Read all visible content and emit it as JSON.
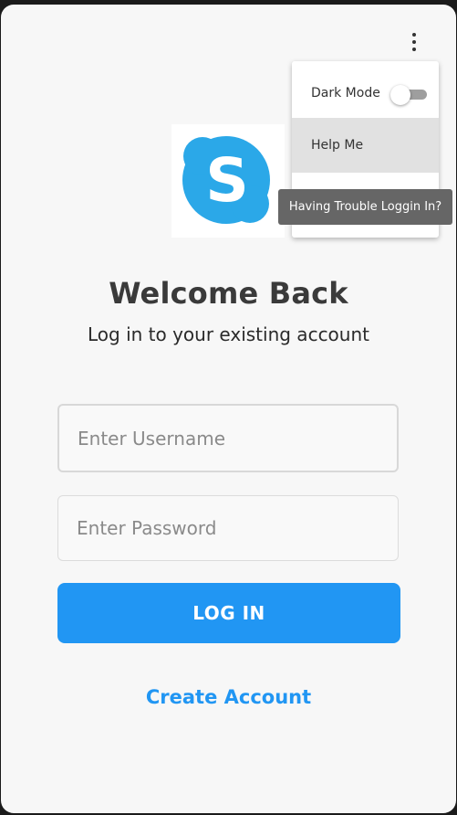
{
  "header": {
    "menu_icon": "more-vertical-icon"
  },
  "logo": {
    "icon": "skype-logo",
    "letter": "S",
    "color": "#2ba8e8"
  },
  "login": {
    "title": "Welcome Back",
    "subtitle": "Log in to your existing account",
    "username_placeholder": "Enter Username",
    "username_value": "",
    "password_placeholder": "Enter Password",
    "password_value": "",
    "login_label": "LOG IN",
    "create_account_label": "Create Account"
  },
  "menu": {
    "dark_mode_label": "Dark Mode",
    "dark_mode_on": false,
    "help_label": "Help Me",
    "help_tooltip": "Having Trouble Loggin In?"
  },
  "colors": {
    "accent": "#2196f3",
    "background": "#f7f7f7",
    "menu_hover": "#e1e1e1",
    "tooltip": "#666666"
  }
}
